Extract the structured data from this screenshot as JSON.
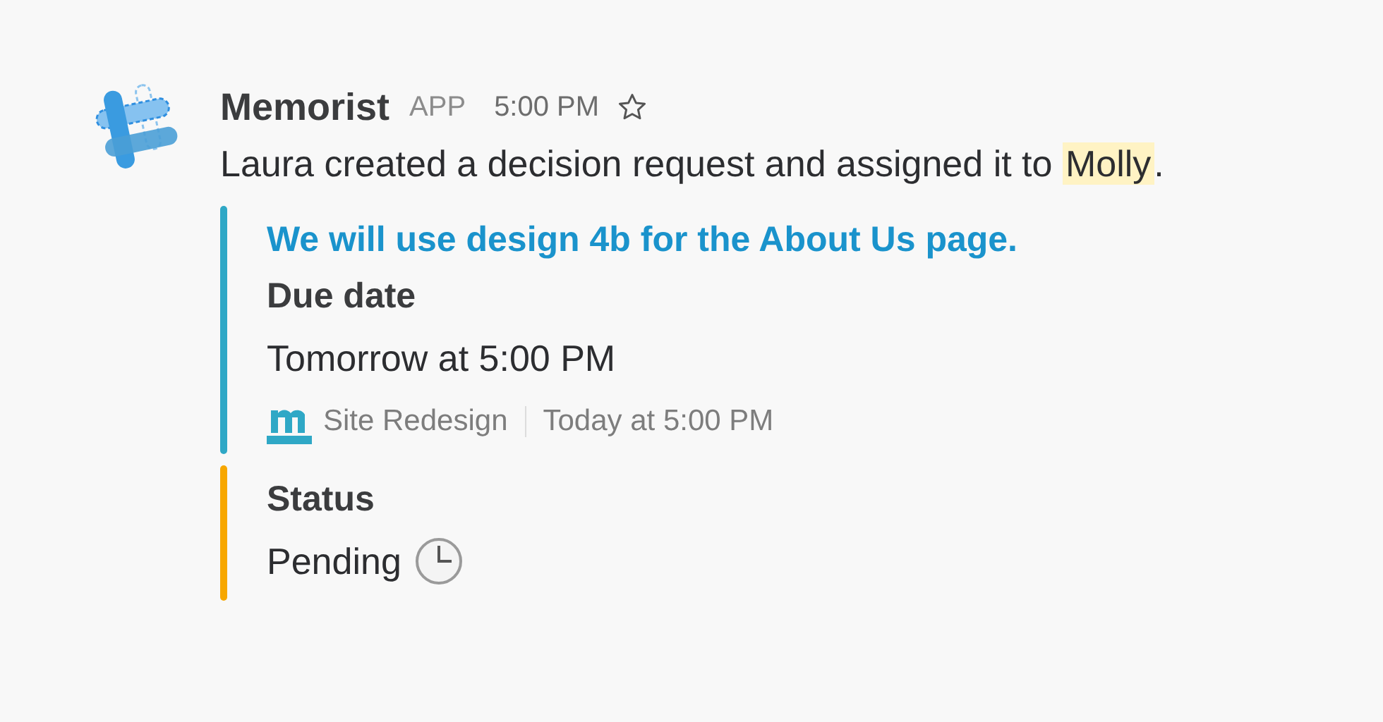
{
  "message": {
    "sender": "Memorist",
    "badge": "APP",
    "time": "5:00 PM",
    "starred": false,
    "text": "Laura created a decision request and assigned it to ",
    "mention": "Molly",
    "text_end": "."
  },
  "attachments": [
    {
      "color": "#2fa8c6",
      "title": "We will use design 4b for the About Us page.",
      "fields": [
        {
          "title": "Due date",
          "value": "Tomorrow at 5:00 PM",
          "kind": "text"
        }
      ],
      "footer": {
        "source": "Site Redesign",
        "time": "Today at 5:00 PM"
      }
    },
    {
      "color": "#f7a700",
      "fields": [
        {
          "title": "Status",
          "value": "Pending",
          "kind": "clock"
        }
      ]
    }
  ]
}
